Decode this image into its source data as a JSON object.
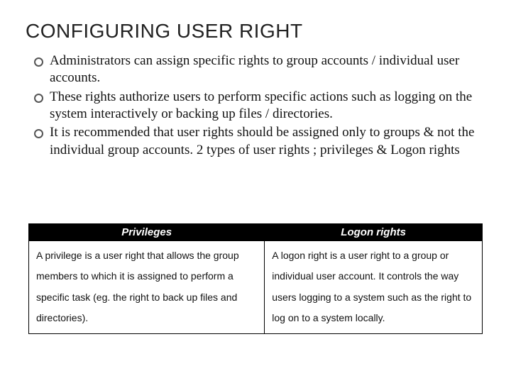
{
  "title": "CONFIGURING USER RIGHT",
  "bullets": [
    "Administrators can assign specific rights to group accounts / individual user accounts.",
    "These rights authorize users to perform specific actions such as logging on the system interactively or backing up files / directories.",
    "It is recommended that user rights should be assigned only to groups & not the individual group accounts. 2 types of user rights ; privileges & Logon rights"
  ],
  "table": {
    "headers": [
      "Privileges",
      "Logon rights"
    ],
    "rows": [
      [
        "A privilege is a user right that allows the group members to which it is assigned to perform a specific task (eg. the right to back up files and directories).",
        "A logon right is a user right to a group or individual user account. It controls the way users logging to a system such as the right to log on to a system locally."
      ]
    ]
  }
}
